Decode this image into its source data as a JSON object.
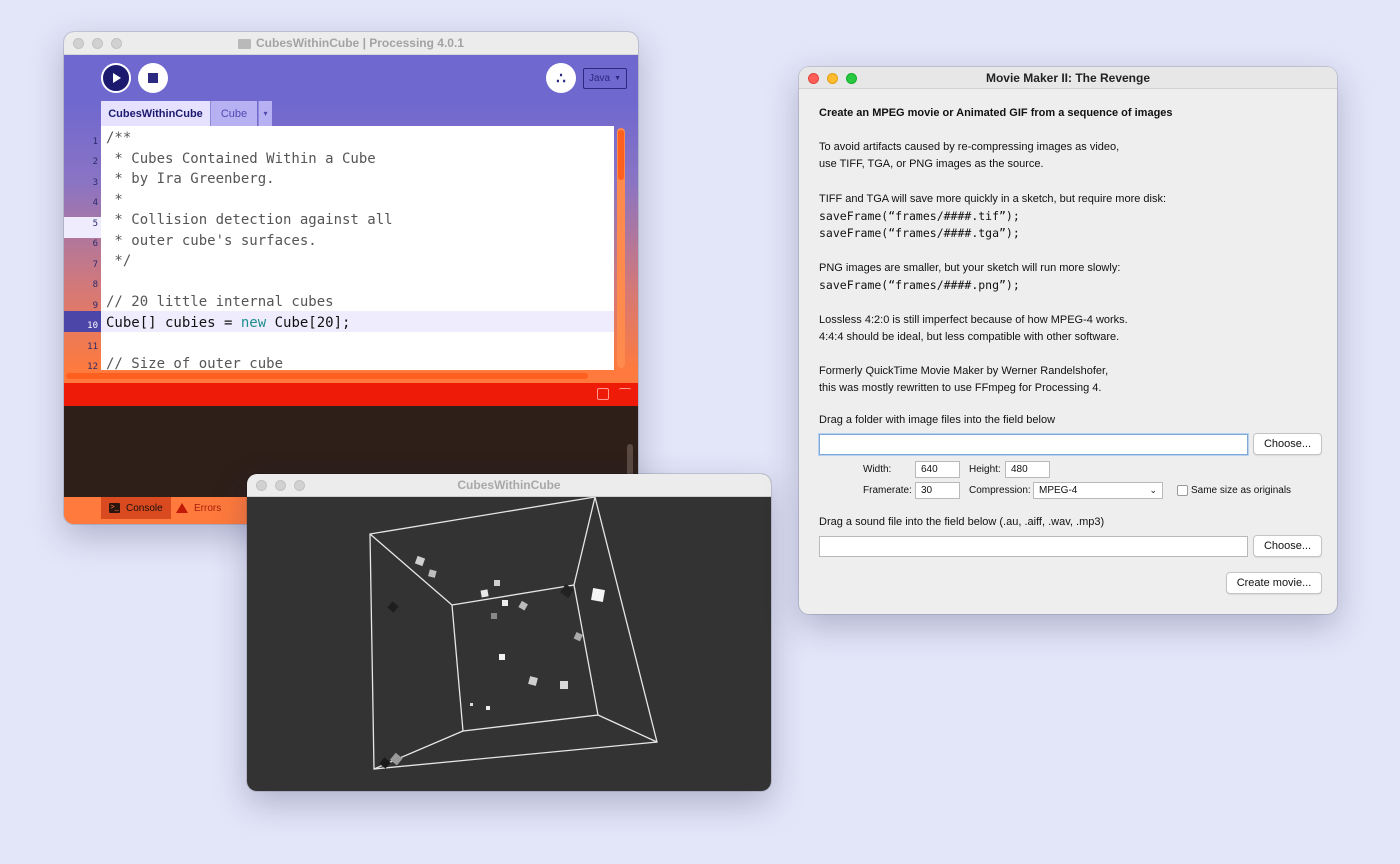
{
  "ide": {
    "title": "CubesWithinCube | Processing 4.0.1",
    "mode": "Java",
    "tabs": [
      "CubesWithinCube",
      "Cube"
    ],
    "tab_menu": "▾",
    "line_numbers": [
      "1",
      "2",
      "3",
      "4",
      "5",
      "6",
      "7",
      "8",
      "9",
      "10",
      "11",
      "12"
    ],
    "code": [
      "/**",
      " * Cubes Contained Within a Cube",
      " * by Ira Greenberg.",
      " *",
      " * Collision detection against all",
      " * outer cube's surfaces.",
      " */",
      "",
      "// 20 little internal cubes",
      "Cube[] cubies = ",
      "",
      "// Size of outer cube"
    ],
    "code_line10_keyword": "new",
    "code_line10_rest": " Cube[20];",
    "console_tab": "Console",
    "errors_tab": "Errors",
    "accent_color": "#6d67cf",
    "error_color": "#ee1b09"
  },
  "sketch": {
    "title": "CubesWithinCube"
  },
  "movie": {
    "title": "Movie Maker II: The Revenge",
    "heading": "Create an MPEG movie or Animated GIF from a sequence of images",
    "p1_line1": "To avoid artifacts caused by re-compressing images as video,",
    "p1_line2": "use TIFF, TGA, or PNG images as the source.",
    "p2_line1": "TIFF and TGA will save more quickly in a sketch, but require more disk:",
    "p2_code1": "saveFrame(“frames/####.tif”);",
    "p2_code2": "saveFrame(“frames/####.tga”);",
    "p3_line1": "PNG images are smaller, but your sketch will run more slowly:",
    "p3_code1": "saveFrame(“frames/####.png”);",
    "p4_line1": "Lossless 4:2:0 is still imperfect because of how MPEG-4 works.",
    "p4_line2": "4:4:4 should be ideal, but less compatible with other software.",
    "p5_line1": "Formerly QuickTime Movie Maker by Werner Randelshofer,",
    "p5_line2": "this was mostly rewritten to use FFmpeg for Processing 4.",
    "folder_label": "Drag a folder with image files into the field below",
    "folder_value": "",
    "choose_label": "Choose...",
    "width_label": "Width:",
    "width_value": "640",
    "height_label": "Height:",
    "height_value": "480",
    "framerate_label": "Framerate:",
    "framerate_value": "30",
    "compression_label": "Compression:",
    "compression_value": "MPEG-4",
    "same_size_label": "Same size as originals",
    "sound_label": "Drag a sound file into the field below (.au, .aiff, .wav, .mp3)",
    "sound_value": "",
    "create_label": "Create movie..."
  }
}
